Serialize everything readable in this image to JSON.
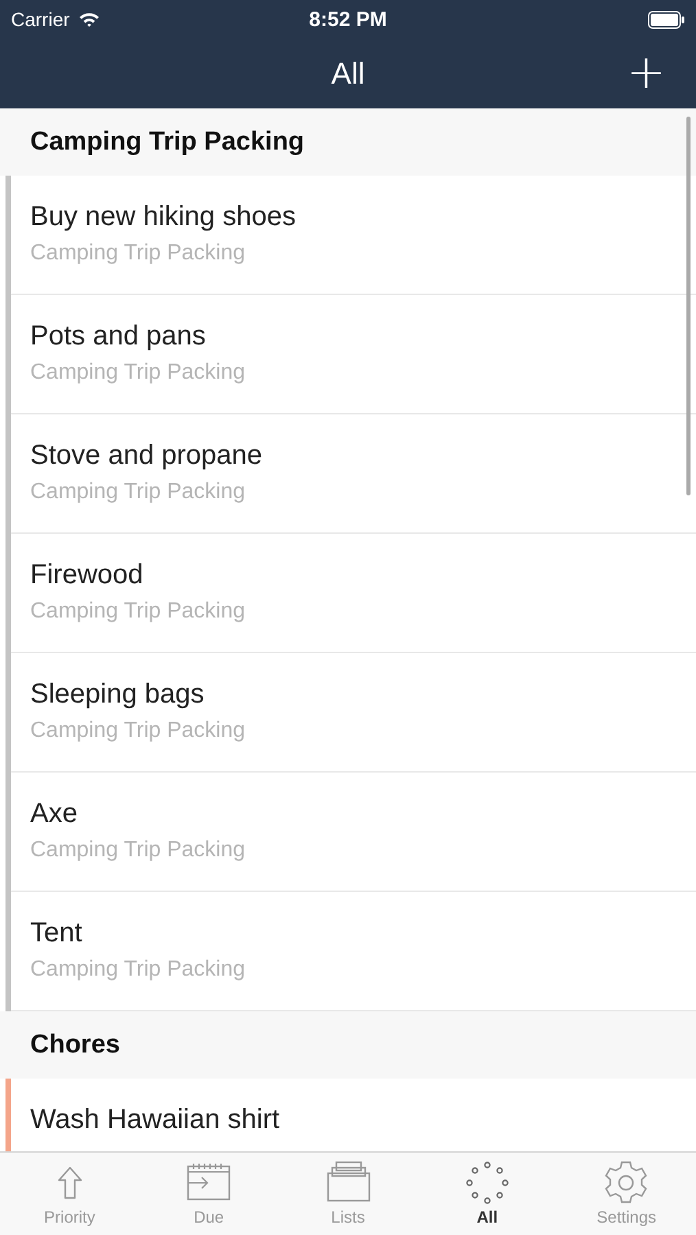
{
  "status_bar": {
    "carrier": "Carrier",
    "time": "8:52 PM"
  },
  "nav": {
    "title": "All",
    "add": "+"
  },
  "sections": [
    {
      "title": "Camping Trip Packing",
      "color": "#c4c4c4",
      "items": [
        {
          "title": "Buy new hiking shoes",
          "subtitle": "Camping Trip Packing"
        },
        {
          "title": "Pots and pans",
          "subtitle": "Camping Trip Packing"
        },
        {
          "title": "Stove and propane",
          "subtitle": "Camping Trip Packing"
        },
        {
          "title": "Firewood",
          "subtitle": "Camping Trip Packing"
        },
        {
          "title": "Sleeping bags",
          "subtitle": "Camping Trip Packing"
        },
        {
          "title": "Axe",
          "subtitle": "Camping Trip Packing"
        },
        {
          "title": "Tent",
          "subtitle": "Camping Trip Packing"
        }
      ]
    },
    {
      "title": "Chores",
      "color": "#f4a58a",
      "items": [
        {
          "title": "Wash Hawaiian shirt"
        }
      ]
    }
  ],
  "tabs": [
    {
      "label": "Priority",
      "kind": "priority",
      "selected": false
    },
    {
      "label": "Due",
      "kind": "due",
      "selected": false
    },
    {
      "label": "Lists",
      "kind": "lists",
      "selected": false
    },
    {
      "label": "All",
      "kind": "all",
      "selected": true
    },
    {
      "label": "Settings",
      "kind": "settings",
      "selected": false
    }
  ]
}
